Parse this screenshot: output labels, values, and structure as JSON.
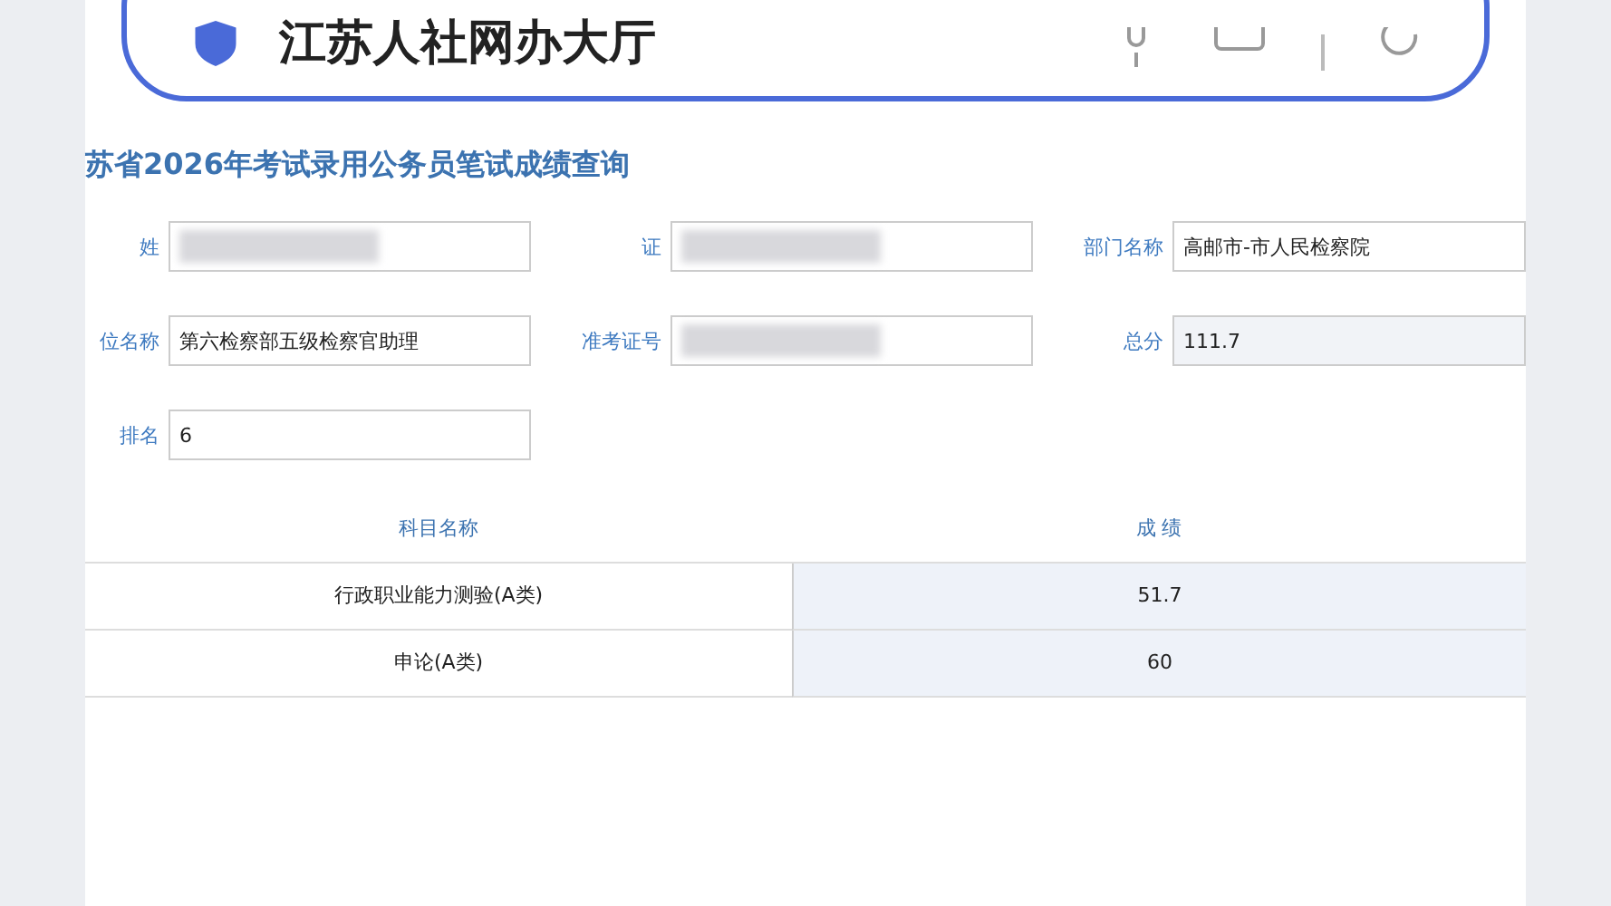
{
  "search_bar": {
    "text": "江苏人社网办大厅"
  },
  "page_title": "苏省2026年考试录用公务员笔试成绩查询",
  "form_fields": [
    {
      "label": "姓",
      "redacted": true
    },
    {
      "label": "证",
      "redacted": true
    },
    {
      "label": "部门名称",
      "value": "高邮市-市人民检察院",
      "redacted": false
    },
    {
      "label": "位名称",
      "value": "第六检察部五级检察官助理",
      "redacted": false
    },
    {
      "label": "准考证号",
      "redacted": true
    },
    {
      "label": "总分",
      "value": "111.7",
      "redacted": false
    },
    {
      "label": "排名",
      "value": "6",
      "redacted": false
    }
  ],
  "table": {
    "columns": [
      "科目名称",
      "成 绩"
    ],
    "rows": [
      [
        "行政职业能力测验(A类)",
        "51.7"
      ],
      [
        "申论(A类)",
        "60"
      ]
    ]
  }
}
